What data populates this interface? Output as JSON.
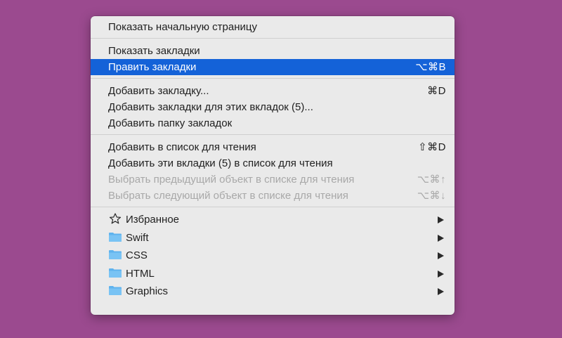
{
  "menu": {
    "group1": [
      {
        "label": "Показать начальную страницу",
        "shortcut": ""
      }
    ],
    "group2": [
      {
        "label": "Показать закладки",
        "shortcut": ""
      },
      {
        "label": "Править закладки",
        "shortcut": "⌥⌘B"
      }
    ],
    "group3": [
      {
        "label": "Добавить закладку...",
        "shortcut": "⌘D"
      },
      {
        "label": "Добавить закладки для этих вкладок (5)...",
        "shortcut": ""
      },
      {
        "label": "Добавить папку закладок",
        "shortcut": ""
      }
    ],
    "group4": [
      {
        "label": "Добавить в список для чтения",
        "shortcut": "⇧⌘D"
      },
      {
        "label": "Добавить эти вкладки (5) в список для чтения",
        "shortcut": ""
      },
      {
        "label": "Выбрать предыдущий объект в списке для чтения",
        "shortcut": "⌥⌘↑"
      },
      {
        "label": "Выбрать следующий объект в списке для чтения",
        "shortcut": "⌥⌘↓"
      }
    ],
    "bookmarks": [
      {
        "label": "Избранное",
        "icon": "star-icon"
      },
      {
        "label": "Swift",
        "icon": "folder-icon"
      },
      {
        "label": "CSS",
        "icon": "folder-icon"
      },
      {
        "label": "HTML",
        "icon": "folder-icon"
      },
      {
        "label": "Graphics",
        "icon": "folder-icon"
      }
    ],
    "selected_color": "#1462d8",
    "folder_color": "#5fb3ee"
  }
}
